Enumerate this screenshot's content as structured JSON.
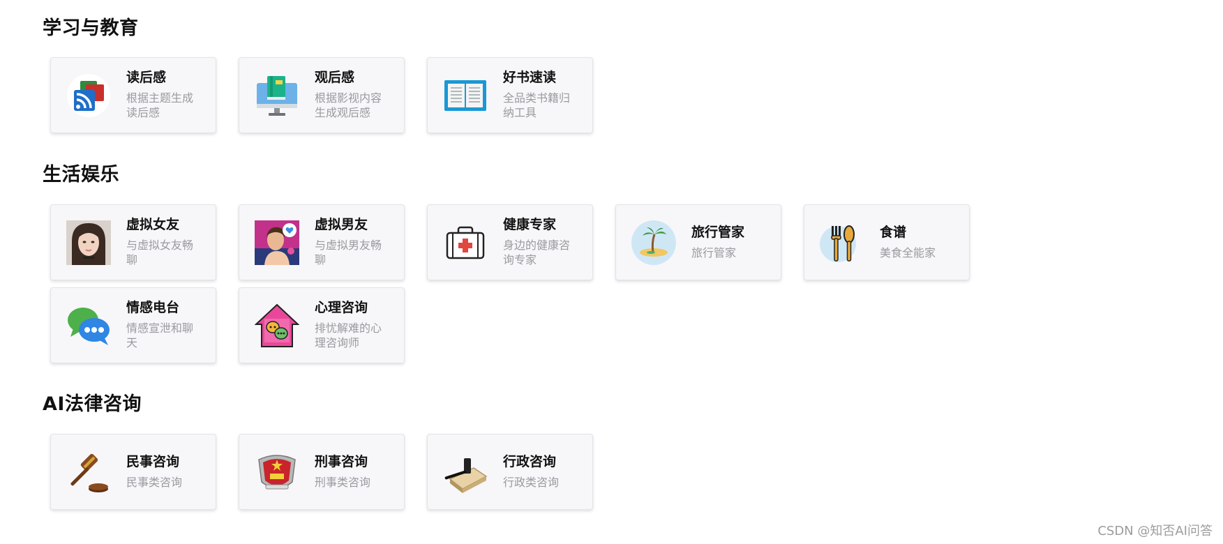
{
  "sections": [
    {
      "title": "学习与教育",
      "cards": [
        {
          "title": "读后感",
          "desc": "根据主题生成读后感",
          "icon": "rss-books-icon"
        },
        {
          "title": "观后感",
          "desc": "根据影视内容生成观后感",
          "icon": "monitor-book-icon"
        },
        {
          "title": "好书速读",
          "desc": "全品类书籍归纳工具",
          "icon": "open-book-icon"
        }
      ]
    },
    {
      "title": "生活娱乐",
      "cards": [
        {
          "title": "虚拟女友",
          "desc": "与虚拟女友畅聊",
          "icon": "girlfriend-avatar-icon"
        },
        {
          "title": "虚拟男友",
          "desc": "与虚拟男友畅聊",
          "icon": "boyfriend-avatar-icon"
        },
        {
          "title": "健康专家",
          "desc": "身边的健康咨询专家",
          "icon": "first-aid-kit-icon"
        },
        {
          "title": "旅行管家",
          "desc": "旅行管家",
          "icon": "palm-island-icon"
        },
        {
          "title": "食谱",
          "desc": "美食全能家",
          "icon": "fork-spoon-icon"
        },
        {
          "title": "情感电台",
          "desc": "情感宣泄和聊天",
          "icon": "chat-bubbles-icon"
        },
        {
          "title": "心理咨询",
          "desc": "排忧解难的心理咨询师",
          "icon": "house-chat-icon"
        }
      ]
    },
    {
      "title": "AI法律咨询",
      "cards": [
        {
          "title": "民事咨询",
          "desc": "民事类咨询",
          "icon": "gavel-icon"
        },
        {
          "title": "刑事咨询",
          "desc": "刑事类咨询",
          "icon": "police-badge-icon"
        },
        {
          "title": "行政咨询",
          "desc": "行政类咨询",
          "icon": "gavel-block-icon"
        }
      ]
    }
  ],
  "watermark": "CSDN @知否AI问答",
  "colors": {
    "card_bg": "#f7f7f9",
    "desc_text": "#9a9aa0",
    "title_text": "#111111"
  }
}
